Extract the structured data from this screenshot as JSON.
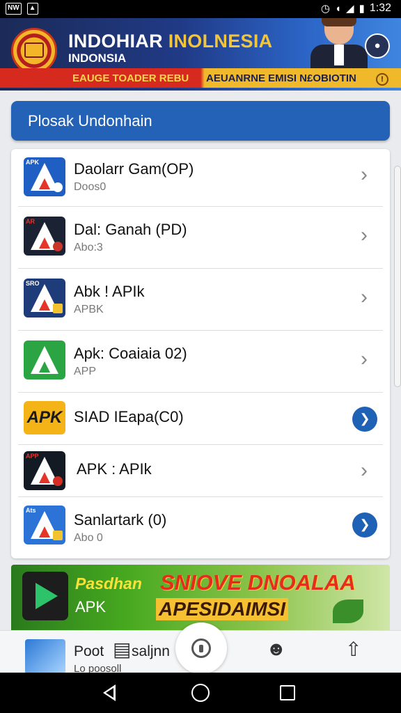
{
  "status_bar": {
    "left_chip_1": "NW",
    "time": "1:32"
  },
  "banner": {
    "title_white": "INDOHIAR",
    "title_gold": " INOLNESIA",
    "subtitle": "INDONSIA",
    "ticker_left": "EAUGE TOADER REBU",
    "ticker_right": "AEUANRNE EMISI N£OBIOTIN",
    "alert": "!",
    "colors": {
      "primary": "#203a86",
      "red": "#d52a1d",
      "gold": "#f0b92c"
    }
  },
  "section_header": {
    "title": "Plosak Undonhain",
    "color": "#2362b6"
  },
  "apps": [
    {
      "name": "Daolarr Gam(OP)",
      "sub": "Doos0",
      "icon_label": "APK",
      "icon_color": "#1f5fc4",
      "action": "chevron"
    },
    {
      "name": "Dal: Ganah (PD)",
      "sub": "Abo:3",
      "icon_label": "AR",
      "icon_color": "#1b2233",
      "action": "chevron"
    },
    {
      "name": "Abk ! APIk",
      "sub": "APBK",
      "icon_label": "SRO",
      "icon_color": "#1e3b7a",
      "action": "chevron"
    },
    {
      "name": "Apk: Coaiaia 02)",
      "sub": "APP",
      "icon_label": "",
      "icon_color": "#2ba544",
      "action": "chevron"
    },
    {
      "name": "SIAD IEapa(C0)",
      "sub": "",
      "icon_label": "APK",
      "icon_color": "#f4b418",
      "action": "button"
    },
    {
      "name": "APK : APIk",
      "sub": "",
      "icon_label": "APP",
      "icon_color": "#141a24",
      "action": "chevron"
    },
    {
      "name": "Sanlartark (0)",
      "sub": "Abo 0",
      "icon_label": "Ats",
      "icon_color": "#2b73d6",
      "action": "button"
    }
  ],
  "promo": {
    "left_line1": "Pasdhan",
    "left_line2": "APK",
    "headline1": "SNIOVE DNOALAA",
    "headline2": "APESIDAIMSI"
  },
  "bottom_nav": {
    "item_name": "Poot",
    "item_name_cont": "saljnn",
    "item_sub": "Lo poosoll"
  }
}
